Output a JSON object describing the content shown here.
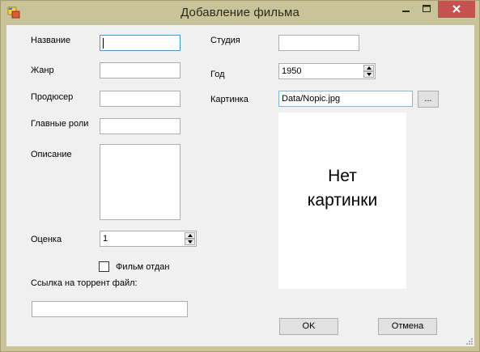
{
  "window": {
    "title": "Добавление фильма",
    "icons": {
      "app": "app-form-icon",
      "minimize": "minimize-icon",
      "maximize": "maximize-icon",
      "close": "close-icon"
    },
    "colors": {
      "frame": "#c9c39a",
      "close": "#c75050",
      "client": "#f0f0f0",
      "focus": "#3399ff"
    }
  },
  "labels": {
    "name": "Название",
    "genre": "Жанр",
    "producer": "Продюсер",
    "actors": "Главные роли",
    "description": "Описание",
    "rating": "Оценка",
    "studio": "Студия",
    "year": "Год",
    "picture": "Картинка",
    "torrent": "Ссылка на торрент файл:"
  },
  "fields": {
    "name": "",
    "genre": "",
    "producer": "",
    "actors": "",
    "description": "",
    "studio": "",
    "torrent": "",
    "picture_path": "Data/Nopic.jpg",
    "year": "1950",
    "rating": "1"
  },
  "checkbox": {
    "label": "Фильм отдан",
    "checked": false
  },
  "picture_box": {
    "line1": "Нет",
    "line2": "картинки"
  },
  "buttons": {
    "browse": "...",
    "ok": "OK",
    "cancel": "Отмена"
  }
}
